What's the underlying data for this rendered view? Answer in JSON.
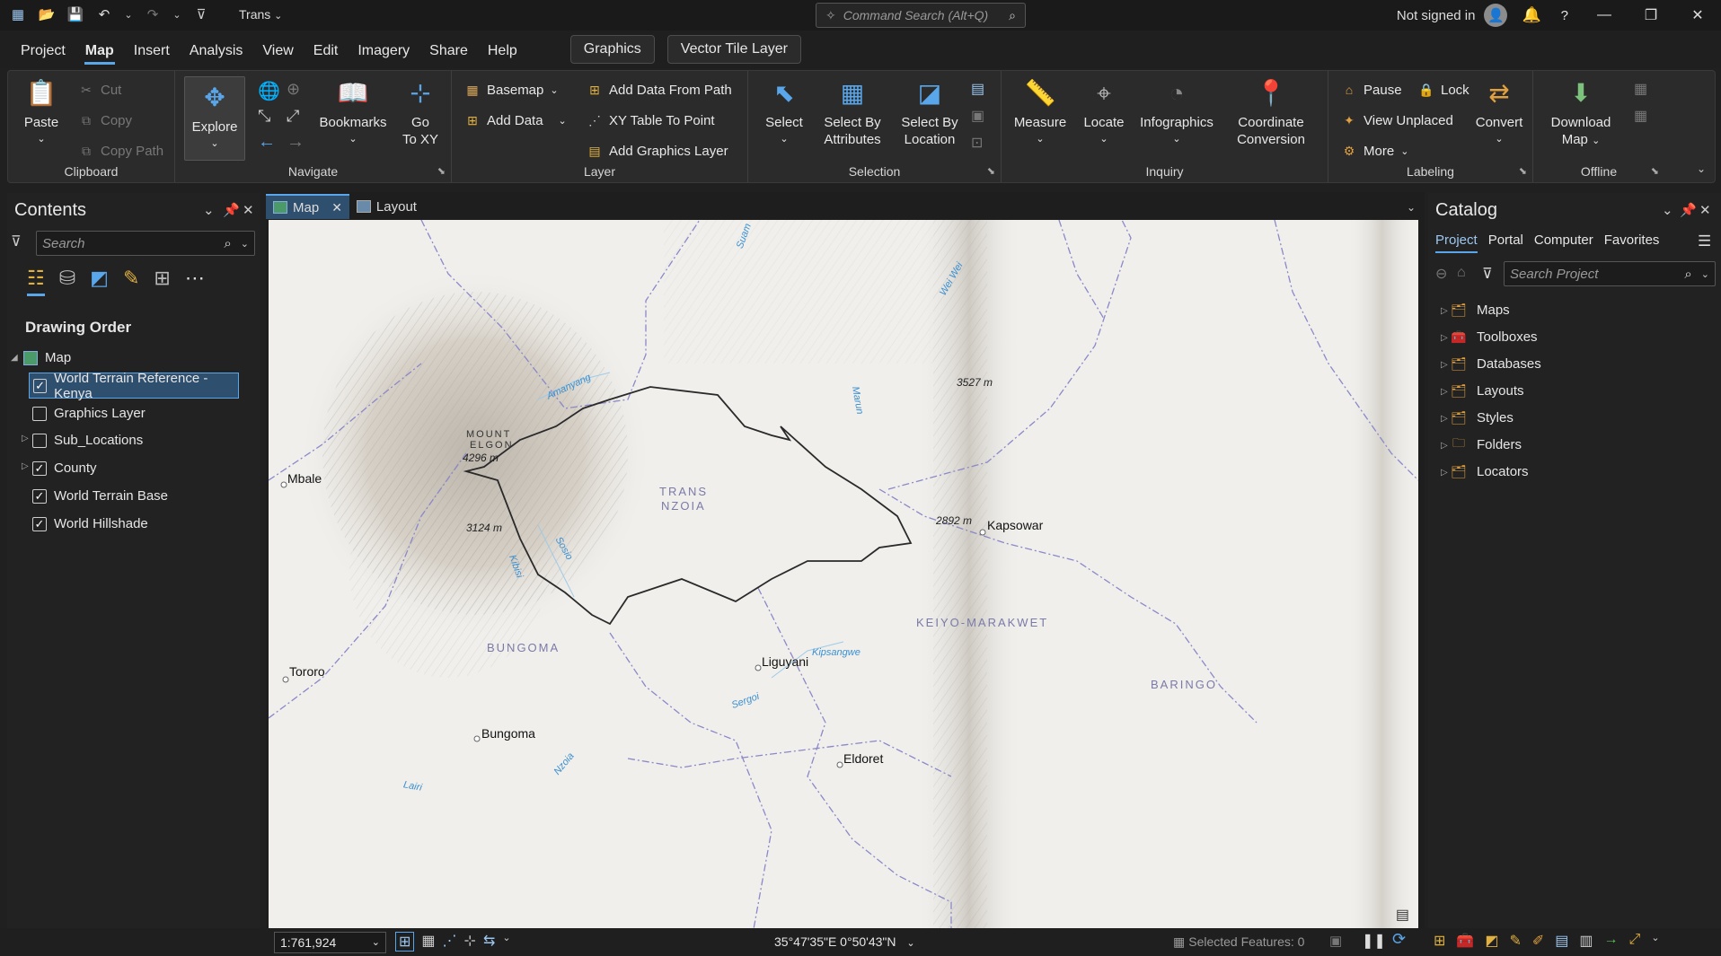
{
  "app": {
    "project_name": "Trans"
  },
  "command_search": {
    "placeholder": "Command Search (Alt+Q)"
  },
  "user": {
    "status": "Not signed in"
  },
  "menu": {
    "items": [
      "Project",
      "Map",
      "Insert",
      "Analysis",
      "View",
      "Edit",
      "Imagery",
      "Share",
      "Help"
    ],
    "contextual": [
      "Graphics",
      "Vector Tile Layer"
    ]
  },
  "ribbon": {
    "clipboard": {
      "label": "Clipboard",
      "paste": "Paste",
      "cut": "Cut",
      "copy": "Copy",
      "copy_path": "Copy Path"
    },
    "navigate": {
      "label": "Navigate",
      "explore": "Explore",
      "bookmarks": "Bookmarks",
      "go_to_xy_1": "Go",
      "go_to_xy_2": "To XY"
    },
    "layer": {
      "label": "Layer",
      "basemap": "Basemap",
      "add_data": "Add Data",
      "add_data_from_path": "Add Data From Path",
      "xy_table_to_point": "XY Table To Point",
      "add_graphics_layer": "Add Graphics Layer"
    },
    "selection": {
      "label": "Selection",
      "select": "Select",
      "select_by_attributes_1": "Select By",
      "select_by_attributes_2": "Attributes",
      "select_by_location_1": "Select By",
      "select_by_location_2": "Location"
    },
    "inquiry": {
      "label": "Inquiry",
      "measure": "Measure",
      "locate": "Locate",
      "infographics": "Infographics",
      "coord_1": "Coordinate",
      "coord_2": "Conversion"
    },
    "labeling": {
      "label": "Labeling",
      "pause": "Pause",
      "lock": "Lock",
      "view_unplaced": "View Unplaced",
      "more": "More",
      "convert": "Convert"
    },
    "offline": {
      "label": "Offline",
      "download_1": "Download",
      "download_2": "Map"
    }
  },
  "contents": {
    "title": "Contents",
    "search_placeholder": "Search",
    "section": "Drawing Order",
    "map_name": "Map",
    "layers": [
      {
        "name": "World Terrain Reference - Kenya",
        "checked": true
      },
      {
        "name": "Graphics Layer",
        "checked": false
      },
      {
        "name": "Sub_Locations",
        "checked": false
      },
      {
        "name": "County",
        "checked": true
      },
      {
        "name": "World Terrain Base",
        "checked": true
      },
      {
        "name": "World Hillshade",
        "checked": true
      }
    ]
  },
  "view_tabs": {
    "map": "Map",
    "layout": "Layout"
  },
  "map": {
    "towns": [
      "Mbale",
      "Tororo",
      "Bungoma",
      "Liguyani",
      "Eldoret",
      "Kapsowar"
    ],
    "regions": [
      "TRANS",
      "NZOIA",
      "BUNGOMA",
      "KEIYO-MARAKWET",
      "BARINGO"
    ],
    "mountain": [
      "MOUNT",
      "ELGON"
    ],
    "altitudes": [
      "4296 m",
      "3124 m",
      "3527 m",
      "2892 m"
    ],
    "rivers": [
      "Suam",
      "Wei Wei",
      "Amanyang",
      "Marun",
      "Sosio",
      "Kibisi",
      "Kipsangwe",
      "Sergoi",
      "Nzoia",
      "Lairi"
    ]
  },
  "catalog": {
    "title": "Catalog",
    "tabs": [
      "Project",
      "Portal",
      "Computer",
      "Favorites"
    ],
    "search_placeholder": "Search Project",
    "items": [
      "Maps",
      "Toolboxes",
      "Databases",
      "Layouts",
      "Styles",
      "Folders",
      "Locators"
    ]
  },
  "status": {
    "scale": "1:761,924",
    "coordinates": "35°47'35\"E 0°50'43\"N",
    "selected_features": "Selected Features: 0"
  },
  "colors": {
    "accent": "#5aa6ea",
    "boundary": "#8b88c9"
  }
}
